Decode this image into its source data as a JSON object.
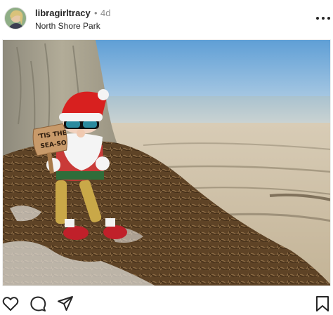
{
  "post": {
    "username": "libragirltracy",
    "separator": "•",
    "age": "4d",
    "location": "North Shore Park"
  },
  "photo": {
    "sign_text_line1": "'TIS THE",
    "sign_text_line2": "SEA-SO"
  },
  "icons": {
    "avatar": "profile-photo",
    "more": "more-options-icon",
    "like": "heart-icon",
    "comment": "comment-icon",
    "share": "paper-plane-icon",
    "save": "bookmark-icon"
  },
  "colors": {
    "text": "#262626",
    "muted": "#8e8e8e",
    "hat_red": "#d8201f",
    "sky": "#7fb0d8",
    "sea": "#b9c7cc",
    "sand": "#c9b79a"
  }
}
